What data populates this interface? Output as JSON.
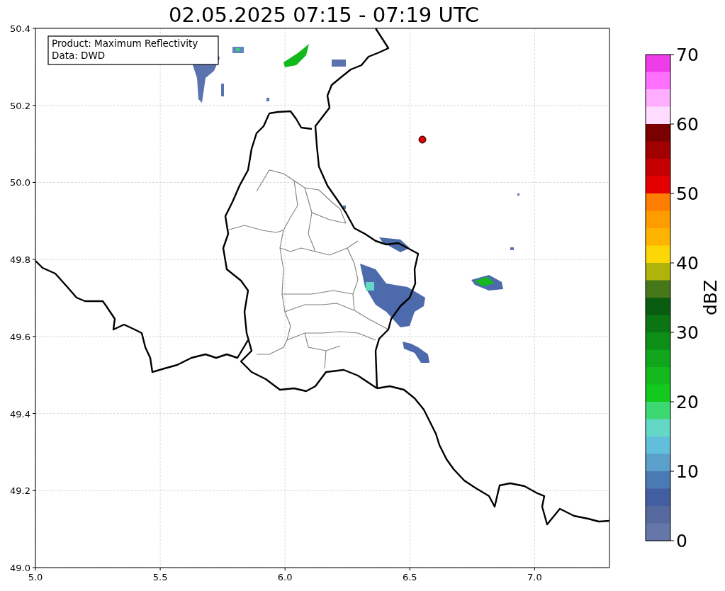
{
  "title": "02.05.2025 07:15 - 07:19 UTC",
  "info_box": {
    "lines": [
      "Product: Maximum Reflectivity",
      "Data: DWD"
    ]
  },
  "map": {
    "x_ticks": [
      "5.0",
      "5.5",
      "6.0",
      "6.5",
      "7.0"
    ],
    "y_ticks": [
      "50.4",
      "50.2",
      "50.0",
      "49.8",
      "49.6",
      "49.4",
      "49.2",
      "49.0"
    ]
  },
  "colorbar": {
    "label": "dBZ",
    "ticks": [
      "70",
      "60",
      "50",
      "40",
      "30",
      "20",
      "10",
      "0"
    ],
    "segments": [
      {
        "color": "#ee3ce8"
      },
      {
        "color": "#ff70ff"
      },
      {
        "color": "#ffaeff"
      },
      {
        "color": "#ffdcff"
      },
      {
        "color": "#7a0000"
      },
      {
        "color": "#a00000"
      },
      {
        "color": "#c60000"
      },
      {
        "color": "#e40000"
      },
      {
        "color": "#ff7d00"
      },
      {
        "color": "#ff9c00"
      },
      {
        "color": "#ffb400"
      },
      {
        "color": "#fdd605"
      },
      {
        "color": "#afb30c"
      },
      {
        "color": "#46781a"
      },
      {
        "color": "#095c10"
      },
      {
        "color": "#0b7413"
      },
      {
        "color": "#0c8e17"
      },
      {
        "color": "#10a51a"
      },
      {
        "color": "#13b91c"
      },
      {
        "color": "#14c91e"
      },
      {
        "color": "#3ed873"
      },
      {
        "color": "#63d8c6"
      },
      {
        "color": "#62bfdb"
      },
      {
        "color": "#5aa0cb"
      },
      {
        "color": "#4a7ab4"
      },
      {
        "color": "#435ea0"
      },
      {
        "color": "#56699f"
      },
      {
        "color": "#6577a8"
      }
    ]
  }
}
